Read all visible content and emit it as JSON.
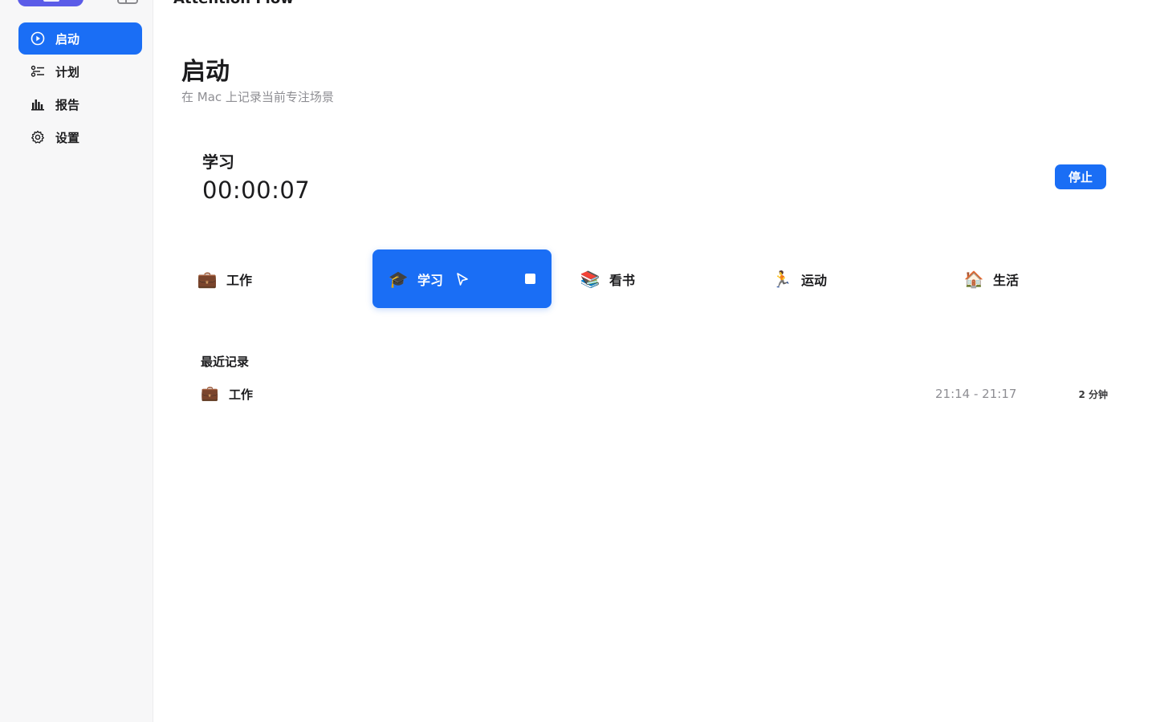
{
  "window": {
    "title": "Attention Flow"
  },
  "sidebar": {
    "items": [
      {
        "label": "启动",
        "icon": "play-circle-icon",
        "active": true
      },
      {
        "label": "计划",
        "icon": "checklist-icon",
        "active": false
      },
      {
        "label": "报告",
        "icon": "bar-chart-icon",
        "active": false
      },
      {
        "label": "设置",
        "icon": "gear-icon",
        "active": false
      }
    ]
  },
  "main": {
    "title": "启动",
    "subtitle": "在 Mac 上记录当前专注场景",
    "current": {
      "scene": "学习",
      "timer": "00:00:07",
      "stop_label": "停止"
    },
    "scenes": [
      {
        "emoji": "💼",
        "label": "工作",
        "active": false
      },
      {
        "emoji": "🎓",
        "label": "学习",
        "active": true
      },
      {
        "emoji": "📚",
        "label": "看书",
        "active": false
      },
      {
        "emoji": "🏃",
        "label": "运动",
        "active": false
      },
      {
        "emoji": "🏠",
        "label": "生活",
        "active": false
      }
    ],
    "recent": {
      "title": "最近记录",
      "rows": [
        {
          "emoji": "💼",
          "name": "工作",
          "time": "21:14 - 21:17",
          "duration": "2 分钟"
        }
      ]
    }
  },
  "colors": {
    "accent": "#1a6ef5",
    "brand": "#5b5ce8",
    "muted": "#8e8e93"
  }
}
